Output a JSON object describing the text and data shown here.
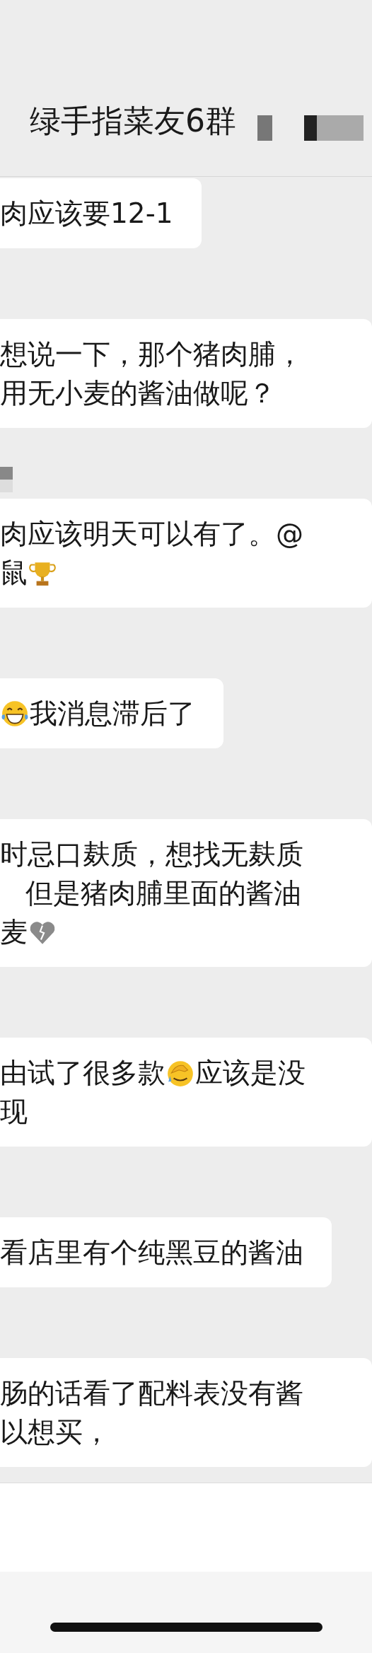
{
  "header": {
    "title": "绿手指菜友6群",
    "redacted": true
  },
  "messages": [
    {
      "redacted_name": false,
      "runs_off_edge": false,
      "lines": [
        {
          "indent": false,
          "parts": [
            {
              "kind": "text",
              "text": "肉应该要12-1"
            }
          ]
        }
      ]
    },
    {
      "redacted_name": false,
      "runs_off_edge": true,
      "lines": [
        {
          "indent": false,
          "parts": [
            {
              "kind": "text",
              "text": "想说一下，那个猪肉脯，"
            }
          ]
        },
        {
          "indent": false,
          "parts": [
            {
              "kind": "text",
              "text": "用无小麦的酱油做呢？"
            }
          ]
        }
      ]
    },
    {
      "redacted_name": true,
      "runs_off_edge": true,
      "lines": [
        {
          "indent": false,
          "parts": [
            {
              "kind": "text",
              "text": "肉应该明天可以有了。@"
            }
          ]
        },
        {
          "indent": false,
          "parts": [
            {
              "kind": "text",
              "text": "鼠"
            },
            {
              "kind": "trophy"
            }
          ]
        }
      ]
    },
    {
      "redacted_name": false,
      "runs_off_edge": false,
      "lines": [
        {
          "indent": false,
          "parts": [
            {
              "kind": "laugh"
            },
            {
              "kind": "text",
              "text": "我消息滞后了"
            }
          ]
        }
      ]
    },
    {
      "redacted_name": false,
      "runs_off_edge": true,
      "lines": [
        {
          "indent": false,
          "parts": [
            {
              "kind": "text",
              "text": "时忌口麸质，想找无麸质"
            }
          ]
        },
        {
          "indent": true,
          "parts": [
            {
              "kind": "text",
              "text": "但是猪肉脯里面的酱油"
            }
          ]
        },
        {
          "indent": false,
          "parts": [
            {
              "kind": "text",
              "text": "麦"
            },
            {
              "kind": "heartbreak"
            }
          ]
        }
      ]
    },
    {
      "redacted_name": false,
      "runs_off_edge": true,
      "lines": [
        {
          "indent": false,
          "parts": [
            {
              "kind": "text",
              "text": "由试了很多款"
            },
            {
              "kind": "facepalm"
            },
            {
              "kind": "text",
              "text": "应该是没"
            }
          ]
        },
        {
          "indent": false,
          "parts": [
            {
              "kind": "text",
              "text": "现"
            }
          ]
        }
      ]
    },
    {
      "redacted_name": false,
      "runs_off_edge": false,
      "lines": [
        {
          "indent": false,
          "parts": [
            {
              "kind": "text",
              "text": "看店里有个纯黑豆的酱油"
            }
          ]
        }
      ]
    },
    {
      "redacted_name": false,
      "runs_off_edge": true,
      "lines": [
        {
          "indent": false,
          "parts": [
            {
              "kind": "text",
              "text": "肠的话看了配料表没有酱"
            }
          ]
        },
        {
          "indent": false,
          "parts": [
            {
              "kind": "text",
              "text": "以想买，"
            }
          ]
        }
      ]
    }
  ]
}
